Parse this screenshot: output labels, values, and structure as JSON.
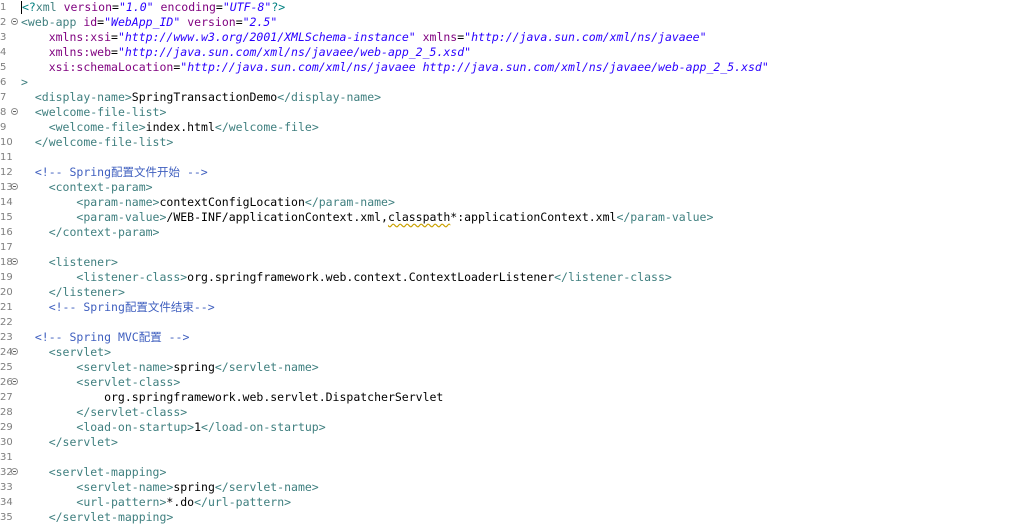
{
  "editor": {
    "lines": [
      {
        "n": "1",
        "fold": false,
        "segs": [
          {
            "c": "pi",
            "t": "<?"
          },
          {
            "c": "tag",
            "t": "xml "
          },
          {
            "c": "attr",
            "t": "version"
          },
          {
            "c": "txt",
            "t": "="
          },
          {
            "c": "val",
            "t": "\"1.0\""
          },
          {
            "c": "txt",
            "t": " "
          },
          {
            "c": "attr",
            "t": "encoding"
          },
          {
            "c": "txt",
            "t": "="
          },
          {
            "c": "val",
            "t": "\"UTF-8\""
          },
          {
            "c": "pi",
            "t": "?>"
          }
        ]
      },
      {
        "n": "2",
        "fold": true,
        "segs": [
          {
            "c": "tag",
            "t": "<web-app "
          },
          {
            "c": "attr",
            "t": "id"
          },
          {
            "c": "txt",
            "t": "="
          },
          {
            "c": "val",
            "t": "\"WebApp_ID\""
          },
          {
            "c": "txt",
            "t": " "
          },
          {
            "c": "attr",
            "t": "version"
          },
          {
            "c": "txt",
            "t": "="
          },
          {
            "c": "val",
            "t": "\"2.5\""
          }
        ]
      },
      {
        "n": "3",
        "fold": false,
        "segs": [
          {
            "c": "txt",
            "t": "    "
          },
          {
            "c": "attr",
            "t": "xmlns:xsi"
          },
          {
            "c": "txt",
            "t": "="
          },
          {
            "c": "val",
            "t": "\"http://www.w3.org/2001/XMLSchema-instance\""
          },
          {
            "c": "txt",
            "t": " "
          },
          {
            "c": "attr",
            "t": "xmlns"
          },
          {
            "c": "txt",
            "t": "="
          },
          {
            "c": "val",
            "t": "\"http://java.sun.com/xml/ns/javaee\""
          }
        ]
      },
      {
        "n": "4",
        "fold": false,
        "segs": [
          {
            "c": "txt",
            "t": "    "
          },
          {
            "c": "attr",
            "t": "xmlns:web"
          },
          {
            "c": "txt",
            "t": "="
          },
          {
            "c": "val",
            "t": "\"http://java.sun.com/xml/ns/javaee/web-app_2_5.xsd\""
          }
        ]
      },
      {
        "n": "5",
        "fold": false,
        "segs": [
          {
            "c": "txt",
            "t": "    "
          },
          {
            "c": "attr",
            "t": "xsi:schemaLocation"
          },
          {
            "c": "txt",
            "t": "="
          },
          {
            "c": "val",
            "t": "\"http://java.sun.com/xml/ns/javaee http://java.sun.com/xml/ns/javaee/web-app_2_5.xsd\""
          }
        ]
      },
      {
        "n": "6",
        "fold": false,
        "segs": [
          {
            "c": "tag",
            "t": ">"
          }
        ]
      },
      {
        "n": "7",
        "fold": false,
        "segs": [
          {
            "c": "txt",
            "t": "  "
          },
          {
            "c": "tag",
            "t": "<display-name>"
          },
          {
            "c": "txt",
            "t": "SpringTransactionDemo"
          },
          {
            "c": "tag",
            "t": "</display-name>"
          }
        ]
      },
      {
        "n": "8",
        "fold": true,
        "segs": [
          {
            "c": "txt",
            "t": "  "
          },
          {
            "c": "tag",
            "t": "<welcome-file-list>"
          }
        ]
      },
      {
        "n": "9",
        "fold": false,
        "segs": [
          {
            "c": "txt",
            "t": "    "
          },
          {
            "c": "tag",
            "t": "<welcome-file>"
          },
          {
            "c": "txt",
            "t": "index.html"
          },
          {
            "c": "tag",
            "t": "</welcome-file>"
          }
        ]
      },
      {
        "n": "10",
        "fold": false,
        "segs": [
          {
            "c": "txt",
            "t": "  "
          },
          {
            "c": "tag",
            "t": "</welcome-file-list>"
          }
        ]
      },
      {
        "n": "11",
        "fold": false,
        "segs": []
      },
      {
        "n": "12",
        "fold": false,
        "segs": [
          {
            "c": "txt",
            "t": "  "
          },
          {
            "c": "cmt",
            "t": "<!-- Spring配置文件开始 -->"
          }
        ]
      },
      {
        "n": "13",
        "fold": true,
        "segs": [
          {
            "c": "txt",
            "t": "    "
          },
          {
            "c": "tag",
            "t": "<context-param>"
          }
        ]
      },
      {
        "n": "14",
        "fold": false,
        "segs": [
          {
            "c": "txt",
            "t": "        "
          },
          {
            "c": "tag",
            "t": "<param-name>"
          },
          {
            "c": "txt",
            "t": "contextConfigLocation"
          },
          {
            "c": "tag",
            "t": "</param-name>"
          }
        ]
      },
      {
        "n": "15",
        "fold": false,
        "segs": [
          {
            "c": "txt",
            "t": "        "
          },
          {
            "c": "tag",
            "t": "<param-value>"
          },
          {
            "c": "txt",
            "t": "/WEB-INF/applicationContext.xml,"
          },
          {
            "c": "txt sq",
            "t": "classpath"
          },
          {
            "c": "txt",
            "t": "*:applicationContext.xml"
          },
          {
            "c": "tag",
            "t": "</param-value>"
          }
        ]
      },
      {
        "n": "16",
        "fold": false,
        "segs": [
          {
            "c": "txt",
            "t": "    "
          },
          {
            "c": "tag",
            "t": "</context-param>"
          }
        ]
      },
      {
        "n": "17",
        "fold": false,
        "segs": []
      },
      {
        "n": "18",
        "fold": true,
        "segs": [
          {
            "c": "txt",
            "t": "    "
          },
          {
            "c": "tag",
            "t": "<listener>"
          }
        ]
      },
      {
        "n": "19",
        "fold": false,
        "segs": [
          {
            "c": "txt",
            "t": "        "
          },
          {
            "c": "tag",
            "t": "<listener-class>"
          },
          {
            "c": "txt",
            "t": "org.springframework.web.context.ContextLoaderListener"
          },
          {
            "c": "tag",
            "t": "</listener-class>"
          }
        ]
      },
      {
        "n": "20",
        "fold": false,
        "segs": [
          {
            "c": "txt",
            "t": "    "
          },
          {
            "c": "tag",
            "t": "</listener>"
          }
        ]
      },
      {
        "n": "21",
        "fold": false,
        "segs": [
          {
            "c": "txt",
            "t": "    "
          },
          {
            "c": "cmt",
            "t": "<!-- Spring配置文件结束-->"
          }
        ]
      },
      {
        "n": "22",
        "fold": false,
        "segs": []
      },
      {
        "n": "23",
        "fold": false,
        "segs": [
          {
            "c": "txt",
            "t": "  "
          },
          {
            "c": "cmt",
            "t": "<!-- Spring MVC配置 -->"
          }
        ]
      },
      {
        "n": "24",
        "fold": true,
        "segs": [
          {
            "c": "txt",
            "t": "    "
          },
          {
            "c": "tag",
            "t": "<servlet>"
          }
        ]
      },
      {
        "n": "25",
        "fold": false,
        "segs": [
          {
            "c": "txt",
            "t": "        "
          },
          {
            "c": "tag",
            "t": "<servlet-name>"
          },
          {
            "c": "txt",
            "t": "spring"
          },
          {
            "c": "tag",
            "t": "</servlet-name>"
          }
        ]
      },
      {
        "n": "26",
        "fold": true,
        "segs": [
          {
            "c": "txt",
            "t": "        "
          },
          {
            "c": "tag",
            "t": "<servlet-class>"
          }
        ]
      },
      {
        "n": "27",
        "fold": false,
        "segs": [
          {
            "c": "txt",
            "t": "            org.springframework.web.servlet.DispatcherServlet"
          }
        ]
      },
      {
        "n": "28",
        "fold": false,
        "segs": [
          {
            "c": "txt",
            "t": "        "
          },
          {
            "c": "tag",
            "t": "</servlet-class>"
          }
        ]
      },
      {
        "n": "29",
        "fold": false,
        "segs": [
          {
            "c": "txt",
            "t": "        "
          },
          {
            "c": "tag",
            "t": "<load-on-startup>"
          },
          {
            "c": "txt",
            "t": "1"
          },
          {
            "c": "tag",
            "t": "</load-on-startup>"
          }
        ]
      },
      {
        "n": "30",
        "fold": false,
        "segs": [
          {
            "c": "txt",
            "t": "    "
          },
          {
            "c": "tag",
            "t": "</servlet>"
          }
        ]
      },
      {
        "n": "31",
        "fold": false,
        "segs": []
      },
      {
        "n": "32",
        "fold": true,
        "segs": [
          {
            "c": "txt",
            "t": "    "
          },
          {
            "c": "tag",
            "t": "<servlet-mapping>"
          }
        ]
      },
      {
        "n": "33",
        "fold": false,
        "segs": [
          {
            "c": "txt",
            "t": "        "
          },
          {
            "c": "tag",
            "t": "<servlet-name>"
          },
          {
            "c": "txt",
            "t": "spring"
          },
          {
            "c": "tag",
            "t": "</servlet-name>"
          }
        ]
      },
      {
        "n": "34",
        "fold": false,
        "segs": [
          {
            "c": "txt",
            "t": "        "
          },
          {
            "c": "tag",
            "t": "<url-pattern>"
          },
          {
            "c": "txt",
            "t": "*.do"
          },
          {
            "c": "tag",
            "t": "</url-pattern>"
          }
        ]
      },
      {
        "n": "35",
        "fold": false,
        "segs": [
          {
            "c": "txt",
            "t": "    "
          },
          {
            "c": "tag",
            "t": "</servlet-mapping>"
          }
        ]
      }
    ]
  }
}
